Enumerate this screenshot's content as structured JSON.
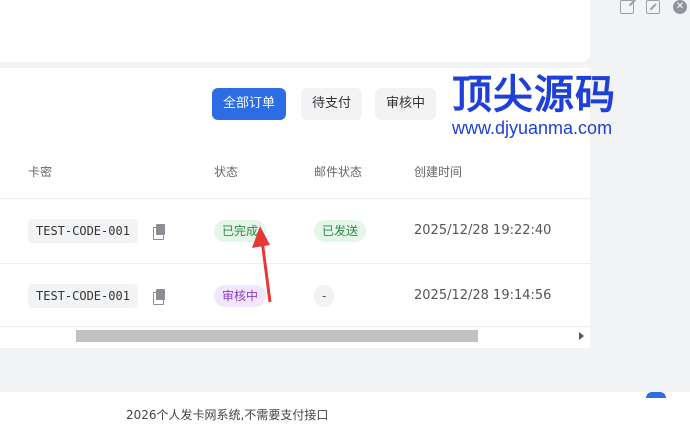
{
  "window_controls": {
    "open_external": "external-link-icon",
    "fullscreen": "fullscreen-icon",
    "close": "close-icon",
    "close_glyph": "✕"
  },
  "tabs": [
    {
      "label": "全部订单",
      "active": true
    },
    {
      "label": "待支付",
      "active": false
    },
    {
      "label": "审核中",
      "active": false
    }
  ],
  "table": {
    "headers": {
      "card_code": "卡密",
      "status": "状态",
      "mail_status": "邮件状态",
      "created_at": "创建时间"
    },
    "rows": [
      {
        "code": "TEST-CODE-001",
        "status": "已完成",
        "mail_status": "已发送",
        "created_at": "2025/12/28 19:22:40"
      },
      {
        "code": "TEST-CODE-001",
        "status": "审核中",
        "mail_status": "-",
        "created_at": "2025/12/28 19:14:56"
      }
    ]
  },
  "watermark": {
    "logo": "顶尖源码",
    "url": "www.djyuanma.com"
  },
  "footer": {
    "text": "2026个人发卡网系统,不需要支付接口"
  },
  "colors": {
    "accent": "#2c6de6",
    "success": "#2e8b4a",
    "pending": "#8a3fc7",
    "annotation": "#e53935"
  }
}
